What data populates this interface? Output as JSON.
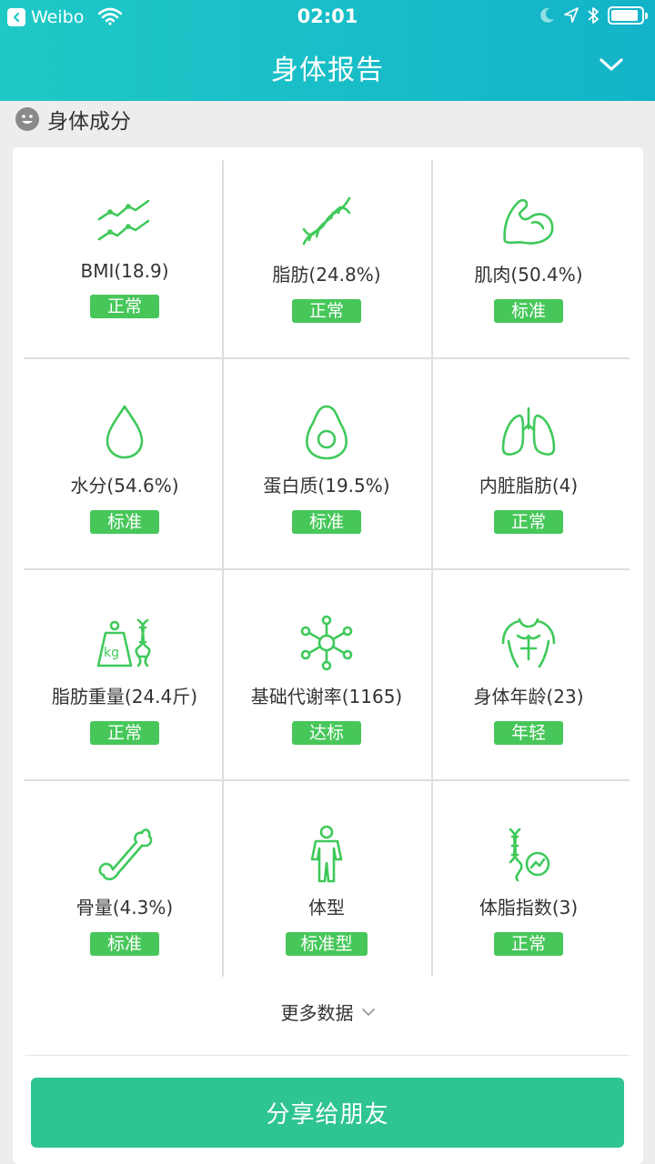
{
  "status_bar": {
    "back_app": "Weibo",
    "time": "02:01",
    "battery_level": 0.9
  },
  "header": {
    "title": "身体报告"
  },
  "section": {
    "title": "身体成分"
  },
  "metrics": [
    {
      "icon": "trend-lines-icon",
      "label": "BMI(18.9)",
      "status": "正常"
    },
    {
      "icon": "dna-icon",
      "label": "脂肪(24.8%)",
      "status": "正常"
    },
    {
      "icon": "muscle-arm-icon",
      "label": "肌肉(50.4%)",
      "status": "标准"
    },
    {
      "icon": "water-drop-icon",
      "label": "水分(54.6%)",
      "status": "标准"
    },
    {
      "icon": "avocado-icon",
      "label": "蛋白质(19.5%)",
      "status": "标准"
    },
    {
      "icon": "lungs-icon",
      "label": "内脏脂肪(4)",
      "status": "正常"
    },
    {
      "icon": "weight-dna-icon",
      "label": "脂肪重量(24.4斤)",
      "status": "正常"
    },
    {
      "icon": "molecule-icon",
      "label": "基础代谢率(1165)",
      "status": "达标"
    },
    {
      "icon": "torso-icon",
      "label": "身体年龄(23)",
      "status": "年轻"
    },
    {
      "icon": "bone-icon",
      "label": "骨量(4.3%)",
      "status": "标准"
    },
    {
      "icon": "body-figure-icon",
      "label": "体型",
      "status": "标准型"
    },
    {
      "icon": "dna-chart-icon",
      "label": "体脂指数(3)",
      "status": "正常"
    }
  ],
  "weight_icon_text": "kg",
  "more_data": "更多数据",
  "share_button": "分享给朋友",
  "colors": {
    "header_start": "#1ec9c6",
    "header_end": "#13b3c9",
    "accent_green": "#47c75a",
    "share_button": "#2fc493"
  }
}
